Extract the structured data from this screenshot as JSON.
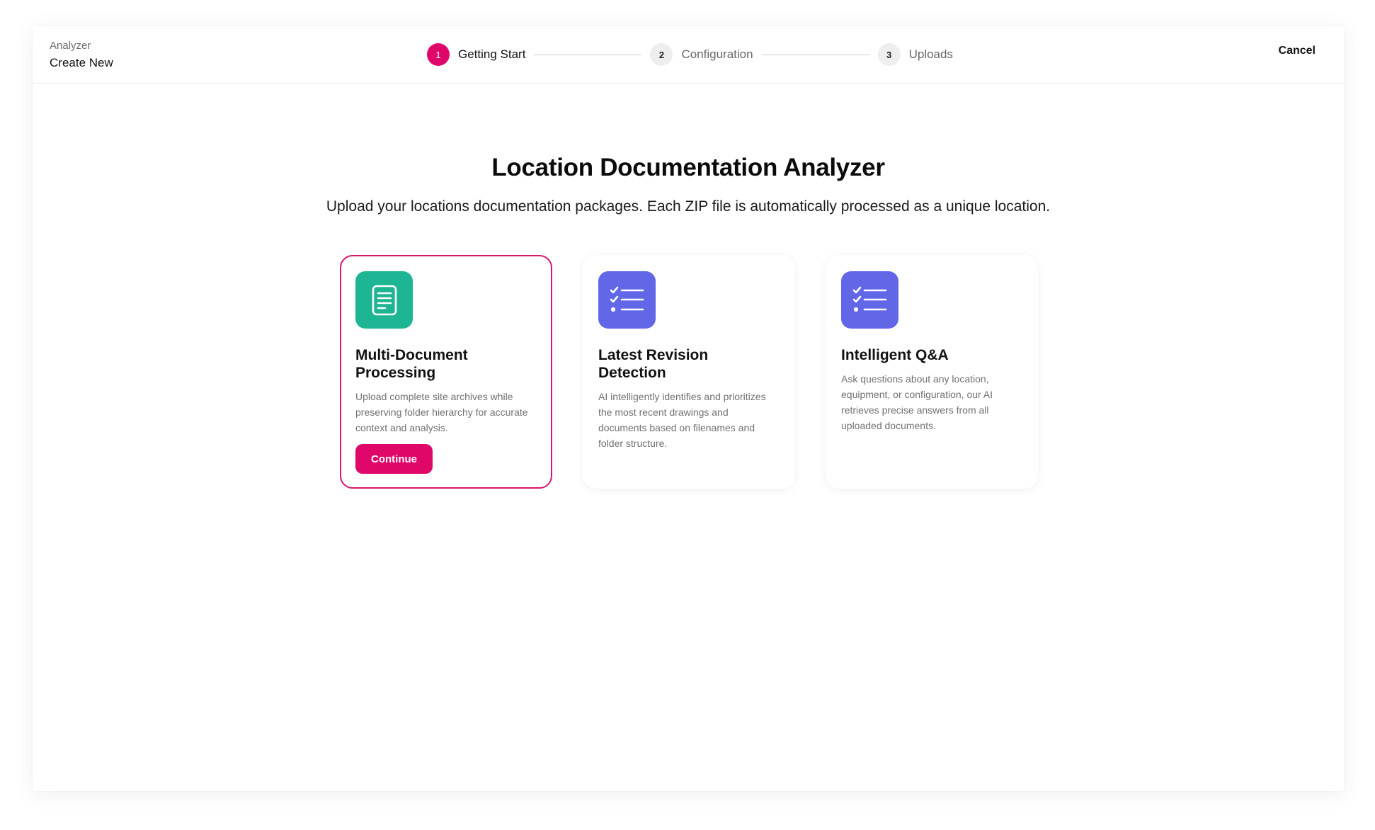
{
  "breadcrumb": {
    "parent": "Analyzer",
    "current": "Create New"
  },
  "stepper": {
    "steps": [
      {
        "number": "1",
        "label": "Getting Start",
        "active": true
      },
      {
        "number": "2",
        "label": "Configuration",
        "active": false
      },
      {
        "number": "3",
        "label": "Uploads",
        "active": false
      }
    ]
  },
  "header": {
    "cancel_label": "Cancel"
  },
  "hero": {
    "title": "Location Documentation Analyzer",
    "subtitle": "Upload your locations documentation packages. Each ZIP file is automatically processed as a unique location."
  },
  "cards": [
    {
      "icon": "document-icon",
      "icon_color": "#1db594",
      "title": "Multi-Document Processing",
      "description": "Upload complete site archives while preserving folder hierarchy for accurate context and analysis.",
      "button_label": "Continue",
      "selected": true
    },
    {
      "icon": "checklist-icon",
      "icon_color": "#6267e8",
      "title": "Latest Revision Detection",
      "description": "AI intelligently identifies and prioritizes the most recent drawings and documents based on filenames and folder structure.",
      "selected": false
    },
    {
      "icon": "checklist-icon",
      "icon_color": "#6267e8",
      "title": "Intelligent Q&A",
      "description": "Ask questions about any location, equipment, or configuration, our AI retrieves precise answers from all uploaded documents.",
      "selected": false
    }
  ],
  "colors": {
    "accent": "#e0076b",
    "selected_border": "#d8156f"
  }
}
